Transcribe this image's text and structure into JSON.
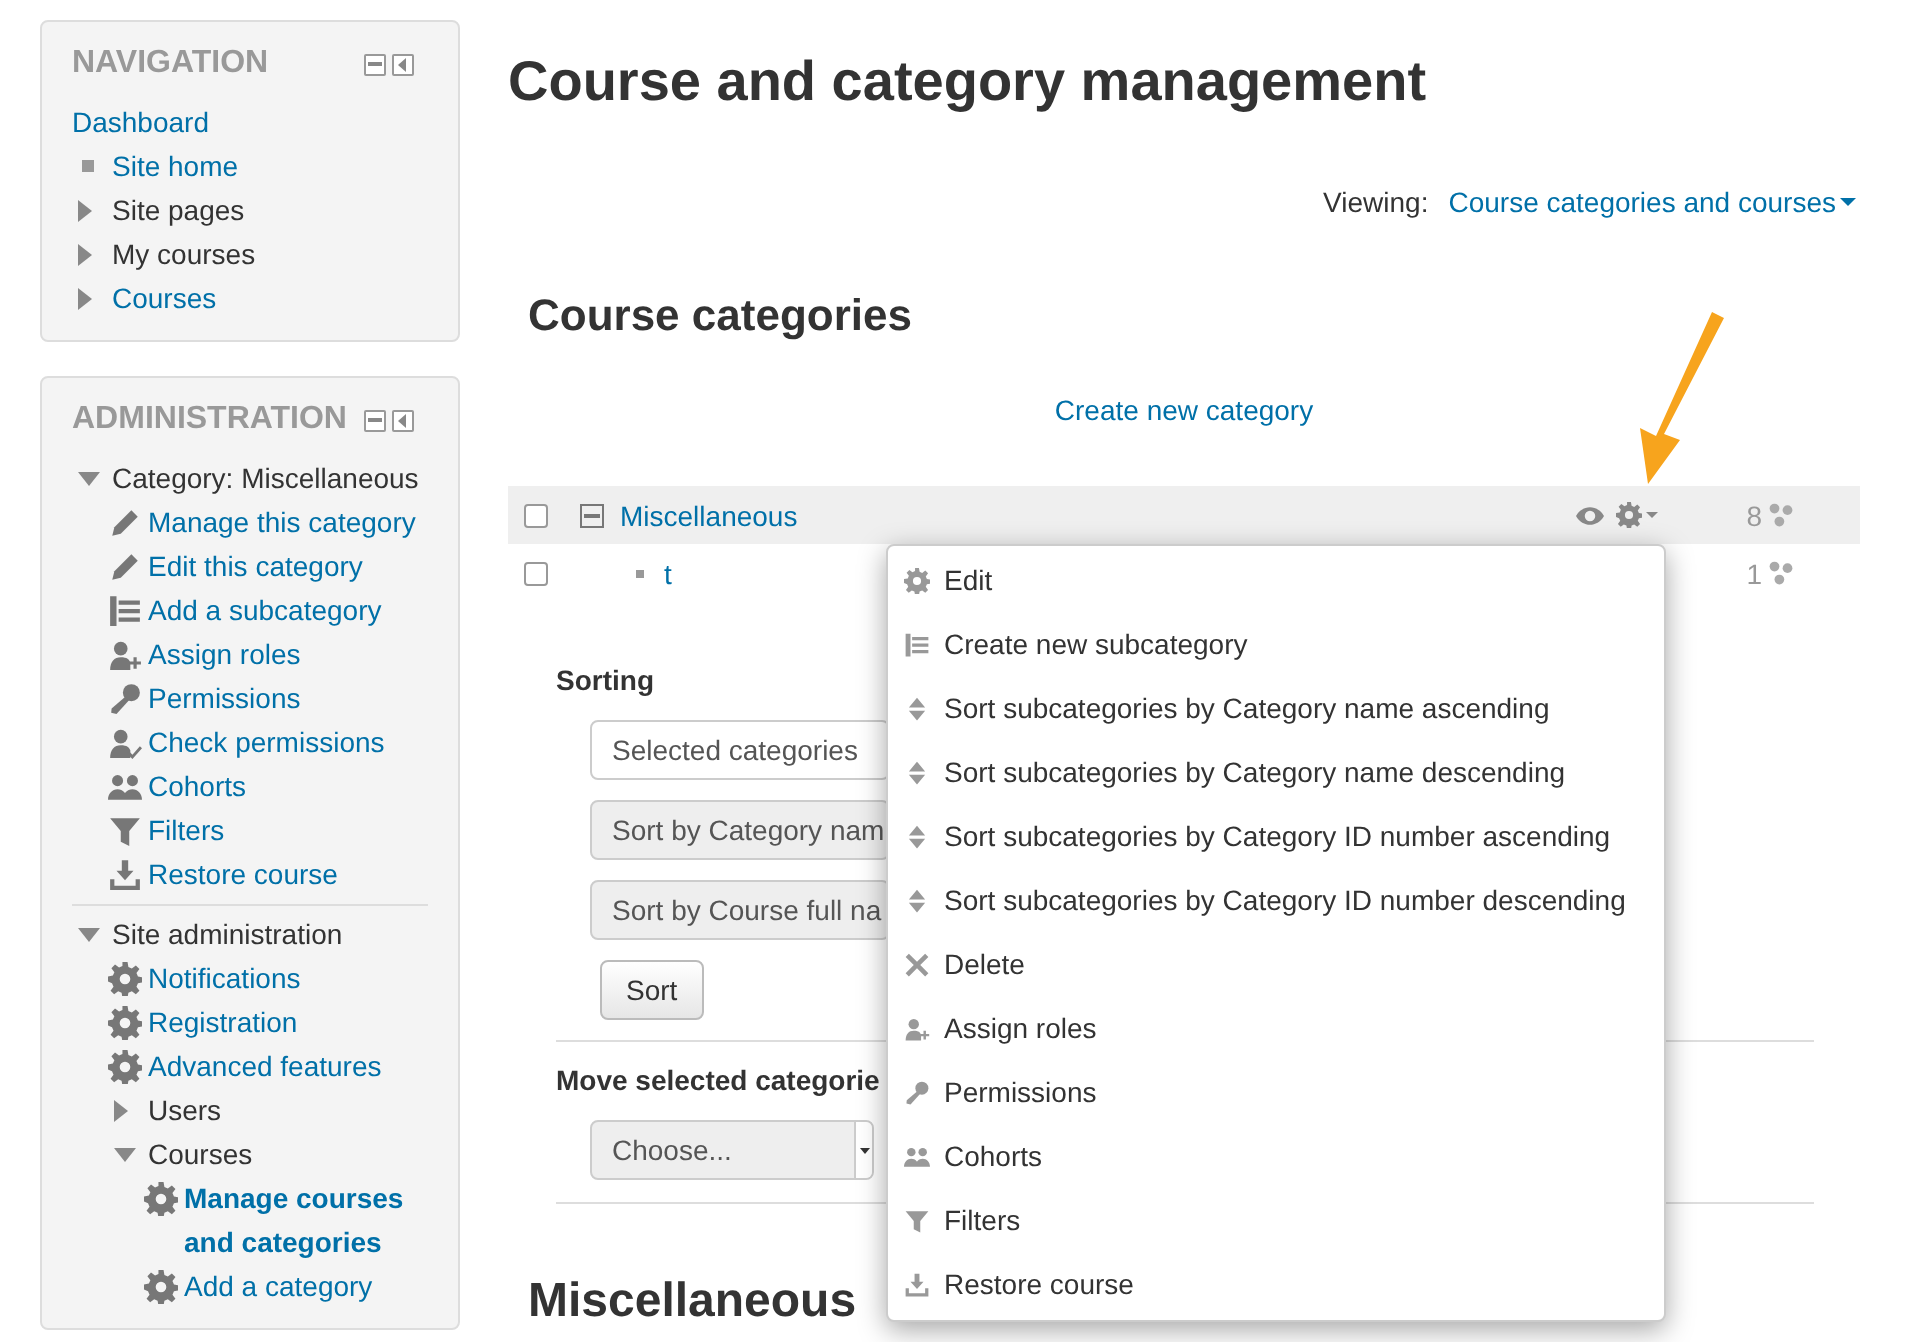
{
  "navigation": {
    "title": "NAVIGATION",
    "items": [
      {
        "label": "Dashboard",
        "kind": "plain",
        "link": true
      },
      {
        "label": "Site home",
        "kind": "leaf",
        "link": true
      },
      {
        "label": "Site pages",
        "kind": "branch",
        "expanded": false,
        "link": false
      },
      {
        "label": "My courses",
        "kind": "branch",
        "expanded": false,
        "link": false
      },
      {
        "label": "Courses",
        "kind": "branch",
        "expanded": false,
        "link": true
      }
    ]
  },
  "administration": {
    "title": "ADMINISTRATION",
    "items": [
      {
        "label": "Category: Miscellaneous",
        "kind": "branch",
        "expanded": true,
        "link": false,
        "children": [
          {
            "label": "Manage this category",
            "kind": "edit",
            "link": true
          },
          {
            "label": "Edit this category",
            "kind": "edit",
            "link": true
          },
          {
            "label": "Add a subcategory",
            "kind": "subcategory",
            "link": true
          },
          {
            "label": "Assign roles",
            "kind": "roles",
            "link": true
          },
          {
            "label": "Permissions",
            "kind": "permissions",
            "link": true
          },
          {
            "label": "Check permissions",
            "kind": "check",
            "link": true
          },
          {
            "label": "Cohorts",
            "kind": "cohorts",
            "link": true
          },
          {
            "label": "Filters",
            "kind": "filters",
            "link": true
          },
          {
            "label": "Restore course",
            "kind": "restore",
            "link": true
          }
        ]
      },
      {
        "label": "Site administration",
        "kind": "branch",
        "expanded": true,
        "link": false,
        "children": [
          {
            "label": "Notifications",
            "kind": "settings",
            "link": true
          },
          {
            "label": "Registration",
            "kind": "settings",
            "link": true
          },
          {
            "label": "Advanced features",
            "kind": "settings",
            "link": true
          },
          {
            "label": "Users",
            "kind": "branch",
            "expanded": false,
            "link": false
          },
          {
            "label": "Courses",
            "kind": "branch",
            "expanded": true,
            "link": false,
            "children": [
              {
                "label": "Manage courses and categories",
                "kind": "settings",
                "link": true,
                "selected": true
              },
              {
                "label": "Add a category",
                "kind": "settings",
                "link": true,
                "selected": false
              }
            ]
          }
        ]
      }
    ]
  },
  "page_title": "Course and category management",
  "viewing": {
    "label": "Viewing:",
    "value": "Course categories and courses"
  },
  "categories": {
    "title": "Course categories",
    "create_link": "Create new category",
    "rows": [
      {
        "name": "Miscellaneous",
        "kind": "parent",
        "expanded": true,
        "checked": false,
        "highlighted": true,
        "count": "8"
      },
      {
        "name": "t",
        "kind": "leaf",
        "checked": false,
        "highlighted": false,
        "count": "1"
      }
    ]
  },
  "sorting": {
    "title": "Sorting",
    "selects": [
      "Selected categories",
      "Sort by Category nam",
      "Sort by Course full na"
    ],
    "button": "Sort"
  },
  "move": {
    "title": "Move selected categorie",
    "select": "Choose..."
  },
  "section_title": "Miscellaneous",
  "action_menu": [
    {
      "label": "Edit",
      "kind": "settings"
    },
    {
      "label": "Create new subcategory",
      "kind": "subcategory"
    },
    {
      "label": "Sort subcategories by Category name ascending",
      "kind": "sort"
    },
    {
      "label": "Sort subcategories by Category name descending",
      "kind": "sort"
    },
    {
      "label": "Sort subcategories by Category ID number ascending",
      "kind": "sort"
    },
    {
      "label": "Sort subcategories by Category ID number descending",
      "kind": "sort"
    },
    {
      "label": "Delete",
      "kind": "delete"
    },
    {
      "label": "Assign roles",
      "kind": "roles"
    },
    {
      "label": "Permissions",
      "kind": "permissions"
    },
    {
      "label": "Cohorts",
      "kind": "cohorts"
    },
    {
      "label": "Filters",
      "kind": "filters"
    },
    {
      "label": "Restore course",
      "kind": "restore"
    }
  ]
}
